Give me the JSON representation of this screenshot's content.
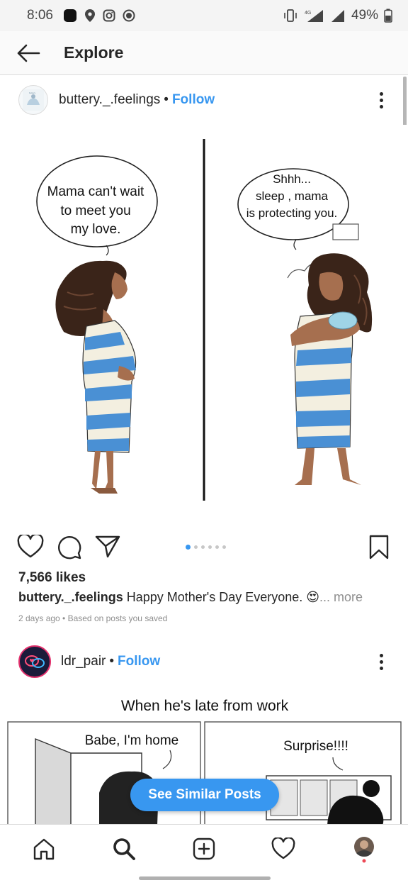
{
  "status_bar": {
    "time": "8:06",
    "battery": "49%"
  },
  "header": {
    "title": "Explore"
  },
  "post1": {
    "username": "buttery._.feelings",
    "separator": "•",
    "follow_label": "Follow",
    "bubble_left": [
      "Mama can't wait",
      "to meet you",
      "my love."
    ],
    "bubble_right": [
      "Shhh...",
      "sleep , mama",
      "is protecting you."
    ],
    "likes": "7,566 likes",
    "caption_username": "buttery._.feelings",
    "caption_text": "Happy Mother's Day Everyone. 😍",
    "caption_more": "... more",
    "meta": "2 days ago • Based on posts you saved",
    "carousel_count": 6,
    "carousel_active": 1
  },
  "post2": {
    "username": "ldr_pair",
    "separator": "•",
    "follow_label": "Follow",
    "comic_title": "When he's late from work",
    "panel_left_text": "Babe, I'm home",
    "panel_right_text": "Surprise!!!!"
  },
  "similar_button": "See Similar Posts",
  "colors": {
    "accent": "#3897f0",
    "text": "#262626",
    "muted": "#8e8e8e",
    "stripe_blue": "#4a90d4",
    "stripe_cream": "#f3efe0"
  },
  "nav": [
    "home-icon",
    "search-icon",
    "new-post-icon",
    "heart-icon",
    "profile-avatar"
  ]
}
